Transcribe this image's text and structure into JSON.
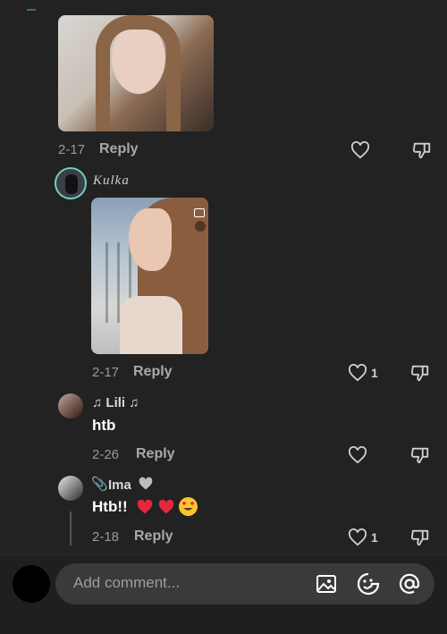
{
  "comments": [
    {
      "date": "2-17",
      "reply_label": "Reply",
      "likes": ""
    },
    {
      "username": "Kulka",
      "date": "2-17",
      "reply_label": "Reply",
      "likes": "1"
    },
    {
      "username": "♫ Lili ♫",
      "text": "htb",
      "date": "2-26",
      "reply_label": "Reply",
      "likes": ""
    },
    {
      "username": "Ima",
      "text": "Htb!!",
      "date": "2-18",
      "reply_label": "Reply",
      "likes": "1"
    }
  ],
  "composer": {
    "placeholder": "Add comment..."
  },
  "icons": {
    "like": "heart-icon",
    "dislike": "thumbs-down-icon",
    "image": "image-icon",
    "sticker": "sticker-icon",
    "mention": "at-icon"
  },
  "colors": {
    "background": "#222222",
    "input": "#3a3a3a",
    "muted": "#9a9a9a",
    "heart": "#e8263b"
  }
}
